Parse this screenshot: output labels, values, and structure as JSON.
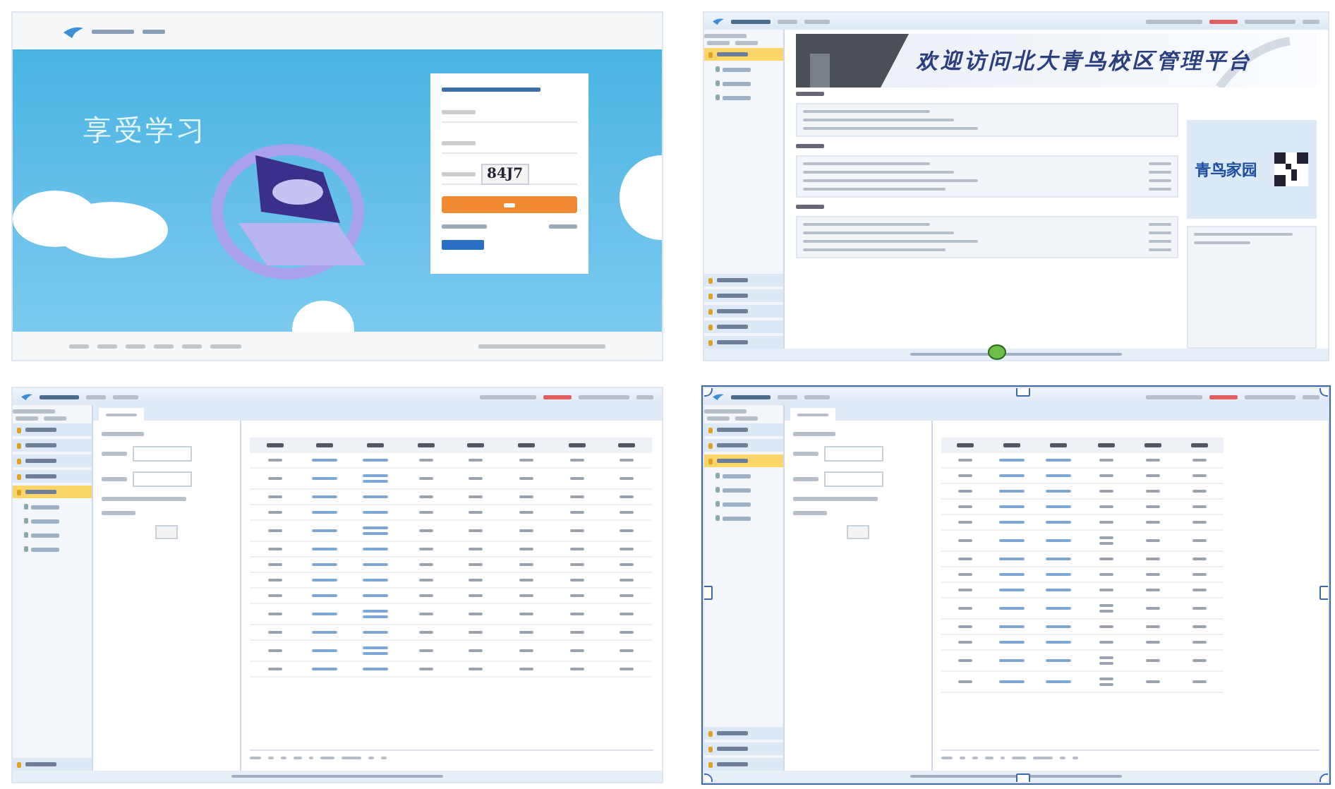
{
  "login_screen": {
    "slogan": "享受学习",
    "captcha": "84J7"
  },
  "home_screen": {
    "banner_title": "欢迎访问北大青鸟校区管理平台",
    "promo_title": "青鸟家园",
    "nav_sections": [
      {
        "selected": true
      },
      {
        "selected": false
      },
      {
        "selected": false
      },
      {
        "selected": false
      },
      {
        "selected": false
      },
      {
        "selected": false
      }
    ]
  },
  "list_screen_a": {
    "selected": false,
    "nav_sections": [
      {
        "selected": false
      },
      {
        "selected": false
      },
      {
        "selected": false
      },
      {
        "selected": false
      },
      {
        "selected": true
      },
      {
        "selected": false
      }
    ],
    "rows": [
      {
        "kind": "single"
      },
      {
        "kind": "double"
      },
      {
        "kind": "single"
      },
      {
        "kind": "single"
      },
      {
        "kind": "double"
      },
      {
        "kind": "single"
      },
      {
        "kind": "single"
      },
      {
        "kind": "single"
      },
      {
        "kind": "single"
      },
      {
        "kind": "double"
      },
      {
        "kind": "single"
      },
      {
        "kind": "double"
      },
      {
        "kind": "single"
      }
    ]
  },
  "list_screen_b": {
    "selected": true,
    "nav_sections": [
      {
        "selected": false
      },
      {
        "selected": false
      },
      {
        "selected": true
      },
      {
        "selected": false
      },
      {
        "selected": false
      },
      {
        "selected": false
      }
    ],
    "rows": [
      {
        "kind": "single"
      },
      {
        "kind": "single"
      },
      {
        "kind": "single"
      },
      {
        "kind": "single"
      },
      {
        "kind": "single"
      },
      {
        "kind": "double"
      },
      {
        "kind": "single"
      },
      {
        "kind": "single"
      },
      {
        "kind": "single"
      },
      {
        "kind": "double"
      },
      {
        "kind": "single"
      },
      {
        "kind": "single"
      },
      {
        "kind": "double"
      },
      {
        "kind": "double"
      }
    ]
  }
}
